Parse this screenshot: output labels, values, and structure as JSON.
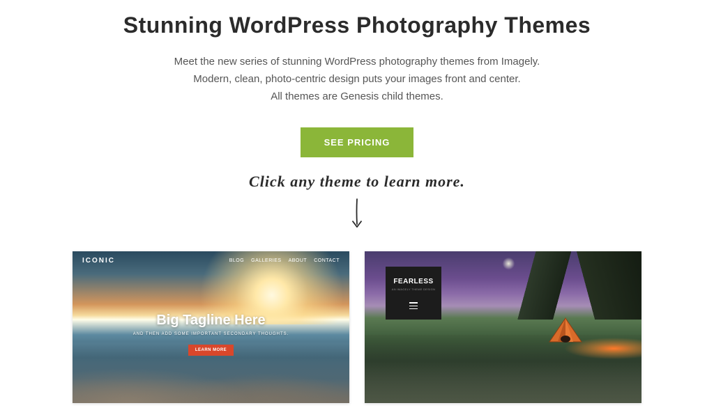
{
  "header": {
    "title": "Stunning WordPress Photography Themes",
    "subtitle_line1": "Meet the new series of stunning WordPress photography themes from Imagely.",
    "subtitle_line2": "Modern, clean, photo-centric design puts your images front and center.",
    "subtitle_line3": "All themes are Genesis child themes."
  },
  "cta": {
    "label": "SEE PRICING"
  },
  "hint": {
    "text": "Click any theme to learn more."
  },
  "themes": [
    {
      "name": "iconic",
      "logo": "ICONIC",
      "nav": [
        "BLOG",
        "GALLERIES",
        "ABOUT",
        "CONTACT"
      ],
      "tagline": "Big Tagline Here",
      "subtagline": "AND THEN ADD SOME IMPORTANT SECONDARY THOUGHTS.",
      "button": "LEARN MORE"
    },
    {
      "name": "fearless",
      "title": "FEARLESS",
      "subtitle": "AN IMAGELY THEME DESIGN"
    }
  ]
}
